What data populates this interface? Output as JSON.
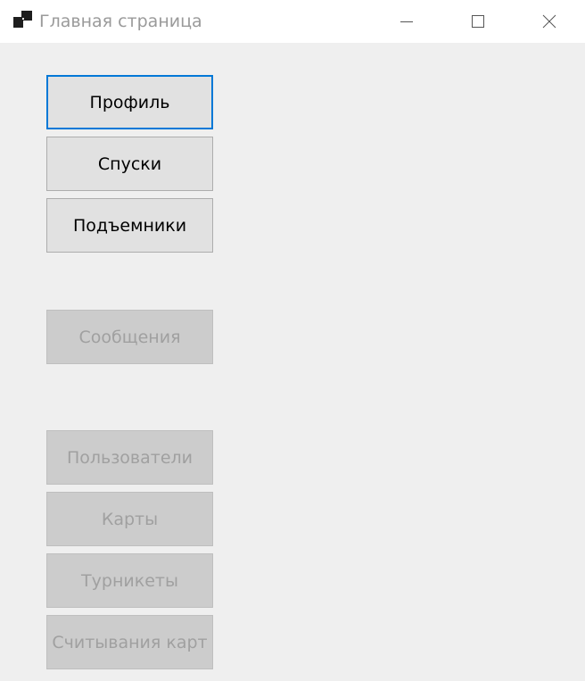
{
  "window": {
    "title": "Главная страница",
    "app_icon": "windows-form-icon",
    "controls": {
      "minimize": "minimize-icon",
      "maximize": "maximize-icon",
      "close": "close-icon"
    }
  },
  "menu": {
    "profile_label": "Профиль",
    "descents_label": "Спуски",
    "lifts_label": "Подъемники",
    "messages_label": "Сообщения",
    "users_label": "Пользователи",
    "cards_label": "Карты",
    "turnstiles_label": "Турникеты",
    "card_reads_label": "Считывания карт"
  },
  "colors": {
    "focus_border": "#0078d7",
    "button_face": "#e1e1e1",
    "disabled_face": "#cccccc",
    "disabled_text": "#a0a0a0"
  }
}
